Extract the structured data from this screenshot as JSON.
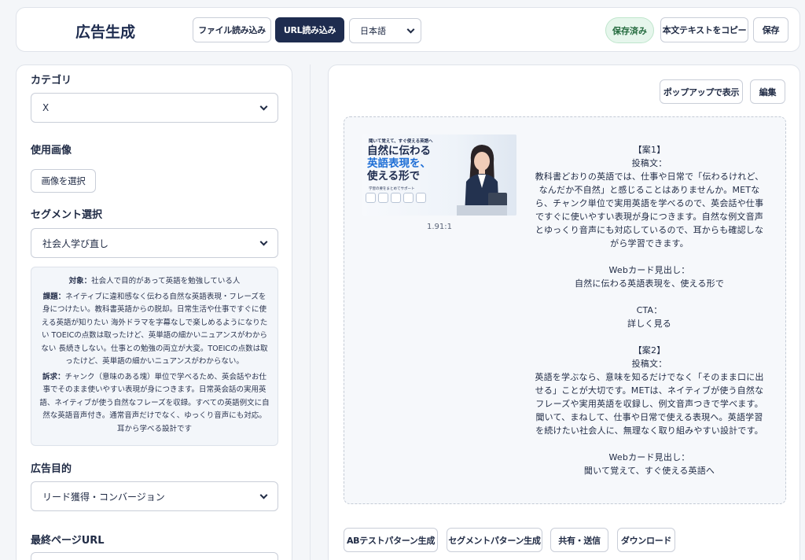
{
  "header": {
    "title": "広告生成",
    "file_import": "ファイル読み込み",
    "url_import": "URL読み込み",
    "language": "日本語",
    "saved_badge": "保存済み",
    "copy_text": "本文テキストをコピー",
    "save": "保存"
  },
  "left": {
    "category_label": "カテゴリ",
    "category_value": "X",
    "image_label": "使用画像",
    "select_image": "画像を選択",
    "segment_label": "セグメント選択",
    "segment_value": "社会人学び直し",
    "target_label": "対象：",
    "target_text": "社会人で目的があって英語を勉強している人",
    "issue_label": "課題：",
    "issue_text": "ネイティブに違和感なく伝わる自然な英語表現・フレーズを身につけたい。教科書英語からの脱却。日常生活や仕事ですぐに使える英語が知りたい 海外ドラマを字幕なしで楽しめるようになりたい TOEICの点数は取ったけど、英単語の細かいニュアンスがわからない 長続きしない。仕事との勉強の両立が大変。TOEICの点数は取ったけど、英単語の細かいニュアンスがわからない。",
    "appeal_label": "訴求：",
    "appeal_text": "チャンク（意味のある塊）単位で学べるため、英会話やお仕事でそのまま使いやすい表現が身につきます。日常英会話の実用英語、ネイティブが使う自然なフレーズを収録。すべての英語例文に自然な英語音声付き。通常音声だけでなく、ゆっくり音声にも対応。耳から学べる設計です",
    "purpose_label": "広告目的",
    "purpose_value": "リード獲得・コンバージョン",
    "url_label": "最終ページURL"
  },
  "right": {
    "popup": "ポップアップで表示",
    "edit": "編集",
    "thumb_top": "聞いて覚えて、すぐ使える英語へ",
    "thumb_line1": "自然に伝わる",
    "thumb_line2": "英語表現を、",
    "thumb_line3": "使える形で",
    "thumb_sub": "学習の要をまとめてサポート",
    "ratio": "1.91:1",
    "copy": "【案1】\n投稿文：\n教科書どおりの英語では、仕事や日常で「伝わるけれど、なんだか不自然」と感じることはありませんか。METなら、チャンク単位で実用英語を学べるので、英会話や仕事ですぐに使いやすい表現が身につきます。自然な例文音声とゆっくり音声にも対応しているので、耳からも確認しながら学習できます。\n\nWebカード見出し：\n自然に伝わる英語表現を、使える形で\n\nCTA：\n詳しく見る\n\n【案2】\n投稿文：\n英語を学ぶなら、意味を知るだけでなく「そのまま口に出せる」ことが大切です。METは、ネイティブが使う自然なフレーズや実用英語を収録し、例文音声つきで学べます。聞いて、まねして、仕事や日常で使える表現へ。英語学習を続けたい社会人に、無理なく取り組みやすい設計です。\n\nWebカード見出し：\n聞いて覚えて、すぐ使える英語へ",
    "ab_test": "ABテストパターン生成",
    "segment_pattern": "セグメントパターン生成",
    "share": "共有・送信",
    "download": "ダウンロード"
  },
  "colors": {
    "primary": "#1e2c4f",
    "accent_blue": "#1f6fd6",
    "saved_bg": "#e6f6ec",
    "saved_text": "#256b3f"
  }
}
